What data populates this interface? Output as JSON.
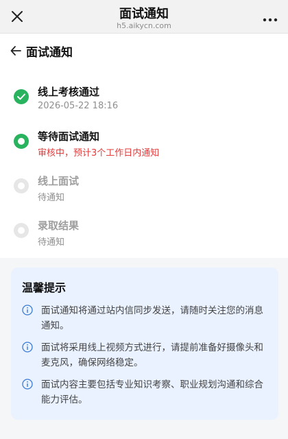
{
  "topbar": {
    "title": "面试通知",
    "domain": "h5.aikycn.com"
  },
  "page": {
    "heading": "面试通知"
  },
  "steps": [
    {
      "name": "线上考核通过",
      "desc": "2026-05-22 18:16",
      "state": "done"
    },
    {
      "name": "等待面试通知",
      "desc": "审核中，预计3个工作日内通知",
      "state": "active"
    },
    {
      "name": "线上面试",
      "desc": "待通知",
      "state": "pending"
    },
    {
      "name": "录取结果",
      "desc": "待通知",
      "state": "pending"
    }
  ],
  "tips": {
    "title": "温馨提示",
    "items": [
      "面试通知将通过站内信同步发送，请随时关注您的消息通知。",
      "面试将采用线上视频方式进行，请提前准备好摄像头和麦克风，确保网络稳定。",
      "面试内容主要包括专业知识考察、职业规划沟通和综合能力评估。"
    ]
  },
  "colors": {
    "success": "#2ab35e",
    "warning_text": "#e33b3b",
    "info_accent": "#3a7bd5",
    "tips_bg": "#eaf2ff"
  }
}
